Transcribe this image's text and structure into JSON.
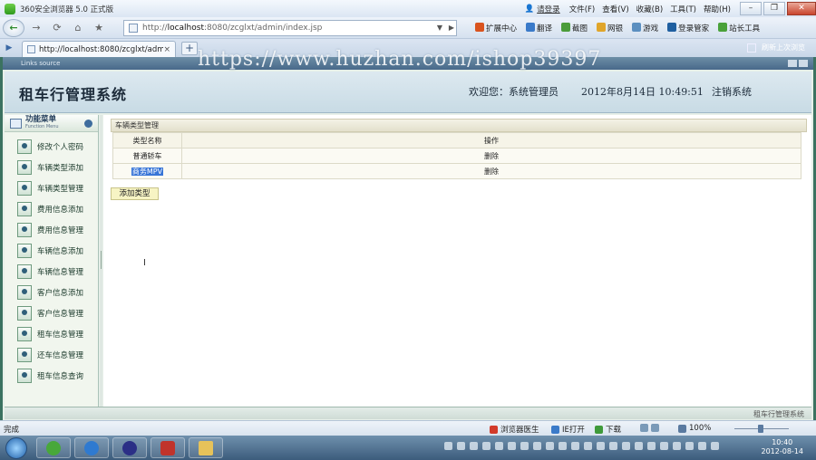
{
  "browser": {
    "title": "360安全浏览器 5.0 正式版",
    "login_label": "请登录",
    "menus": [
      "文件(F)",
      "查看(V)",
      "收藏(B)",
      "工具(T)",
      "帮助(H)"
    ],
    "url_prefix": "http://",
    "url_host": "localhost",
    "url_rest": ":8080/zcglxt/admin/index.jsp",
    "tools": [
      "扩展中心",
      "翻译",
      "截图",
      "网银",
      "游戏",
      "登录管家",
      "站长工具"
    ],
    "tab_title": "http://localhost:8080/zcglxt/admi...",
    "tab_close": "×",
    "new_tab": "+",
    "tabbar_right": "刷新上次浏览",
    "status_left": "完成",
    "status_items": [
      "浏览器医生",
      "IE打开",
      "下载"
    ],
    "zoom": "100%",
    "clock_time": "10:40",
    "clock_date": "2012-08-14"
  },
  "watermark": "https://www.huzhan.com/ishop39397",
  "app": {
    "strip_label": "Links source",
    "title": "租车行管理系统",
    "welcome": "欢迎您：系统管理员",
    "datetime": "2012年8月14日  10:49:51",
    "logout": "注销系统",
    "footer": "租车行管理系统",
    "sidebar": {
      "title": "功能菜单",
      "subtitle": "Function Menu",
      "items": [
        {
          "label": "修改个人密码"
        },
        {
          "label": "车辆类型添加"
        },
        {
          "label": "车辆类型管理"
        },
        {
          "label": "费用信息添加"
        },
        {
          "label": "费用信息管理"
        },
        {
          "label": "车辆信息添加"
        },
        {
          "label": "车辆信息管理"
        },
        {
          "label": "客户信息添加"
        },
        {
          "label": "客户信息管理"
        },
        {
          "label": "租车信息管理"
        },
        {
          "label": "还车信息管理"
        },
        {
          "label": "租车信息查询"
        }
      ]
    },
    "panel": {
      "title": "车辆类型管理",
      "headers": [
        "类型名称",
        "操作"
      ],
      "rows": [
        {
          "name": "普通轿车",
          "action": "删除"
        },
        {
          "name": "商务MPV",
          "action": "删除"
        }
      ],
      "add_button": "添加类型"
    }
  }
}
